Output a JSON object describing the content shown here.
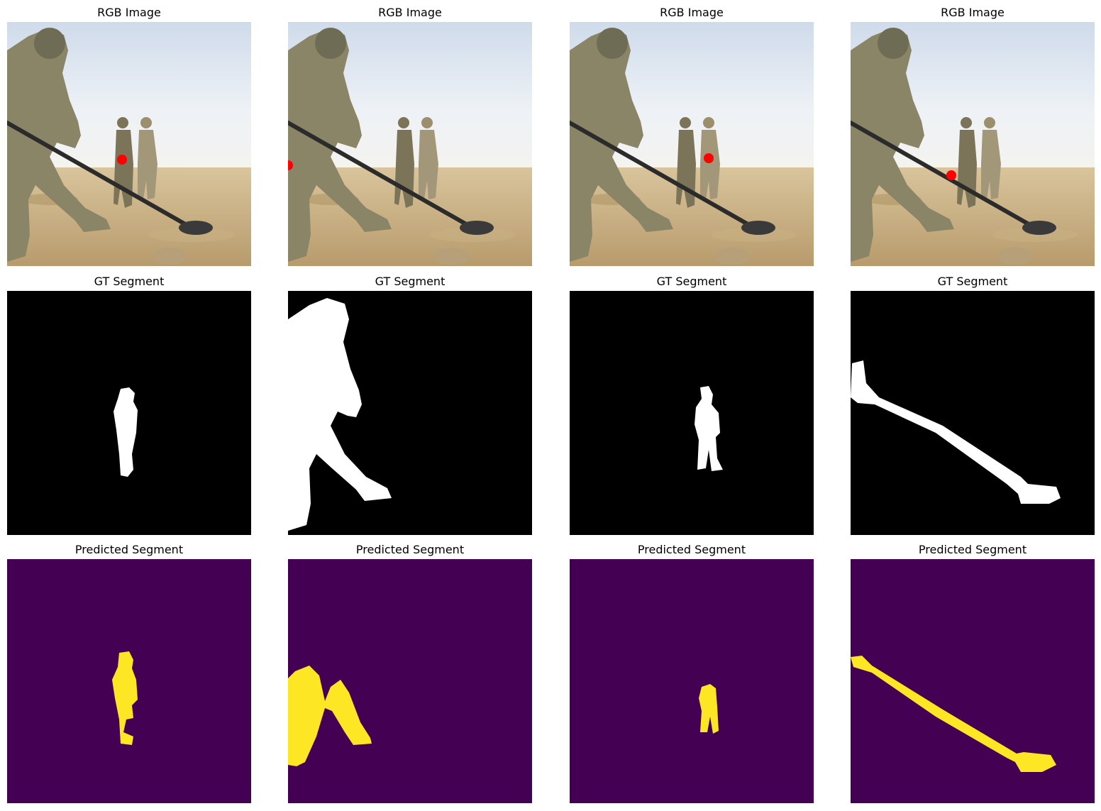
{
  "rows": [
    {
      "title": "RGB Image",
      "kind": "rgb"
    },
    {
      "title": "GT Segment",
      "kind": "gt"
    },
    {
      "title": "Predicted Segment",
      "kind": "pred"
    }
  ],
  "columns": 4,
  "colors": {
    "point": "#ff0000",
    "gt_background": "#000000",
    "gt_foreground": "#ffffff",
    "pred_background": "#440154",
    "pred_foreground": "#fde725",
    "sky": "#dfe8f2",
    "ground": "#cdb58a"
  }
}
